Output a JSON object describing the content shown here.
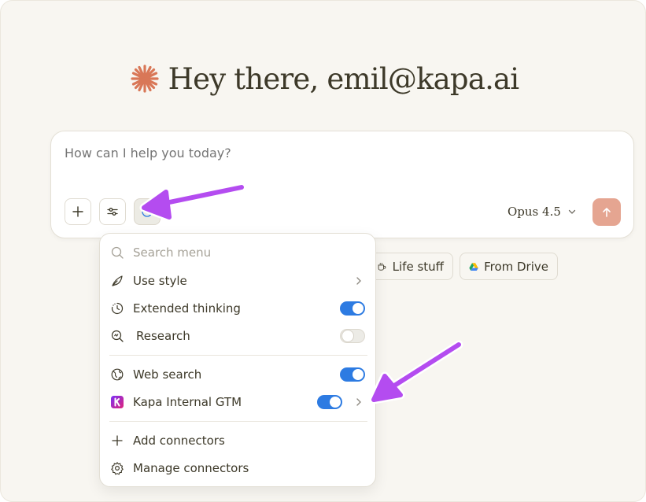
{
  "greeting": {
    "text": "Hey there, emil@kapa.ai"
  },
  "composer": {
    "placeholder": "How can I help you today?",
    "model_label": "Opus 4.5"
  },
  "chips": [
    {
      "label": "Life stuff",
      "icon": "coffee-cup-icon"
    },
    {
      "label": "From Drive",
      "icon": "google-drive-icon"
    }
  ],
  "menu": {
    "search_placeholder": "Search menu",
    "items": [
      {
        "label": "Use style",
        "icon": "feather-pen-icon",
        "control": "submenu"
      },
      {
        "label": "Extended thinking",
        "icon": "clock-icon",
        "control": "toggle",
        "on": true
      },
      {
        "label": "Research",
        "icon": "research-icon",
        "control": "toggle",
        "on": false
      },
      {
        "label": "Web search",
        "icon": "globe-icon",
        "control": "toggle",
        "on": true
      },
      {
        "label": "Kapa Internal GTM",
        "icon": "kapa-logo-icon",
        "control": "toggle+submenu",
        "on": true
      },
      {
        "label": "Add connectors",
        "icon": "plus-icon",
        "control": "none"
      },
      {
        "label": "Manage connectors",
        "icon": "gear-icon",
        "control": "none"
      }
    ]
  },
  "colors": {
    "accent_spark": "#d97757",
    "toggle_on": "#2d7be2",
    "send_button": "#e5a591",
    "annotation_arrow": "#b44cf0"
  }
}
